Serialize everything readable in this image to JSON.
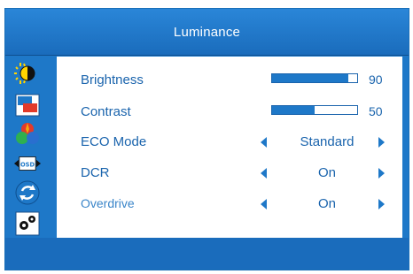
{
  "header": {
    "title": "Luminance"
  },
  "sidebar": {
    "items": [
      {
        "icon": "luminance-icon",
        "selected": true
      },
      {
        "icon": "image-setup-icon",
        "selected": false
      },
      {
        "icon": "color-temperature-icon",
        "selected": false
      },
      {
        "icon": "osd-setup-icon",
        "selected": false
      },
      {
        "icon": "reset-icon",
        "selected": false
      },
      {
        "icon": "extra-settings-icon",
        "selected": false
      }
    ]
  },
  "settings": {
    "brightness": {
      "label": "Brightness",
      "value": "90",
      "level": 0.9
    },
    "contrast": {
      "label": "Contrast",
      "value": "50",
      "level": 0.5
    },
    "eco_mode": {
      "label": "ECO Mode",
      "value": "Standard"
    },
    "dcr": {
      "label": "DCR",
      "value": "On"
    },
    "overdrive": {
      "label": "Overdrive",
      "value": "On"
    }
  },
  "colors": {
    "accent": "#1e78c8",
    "text": "#1a64ad"
  }
}
